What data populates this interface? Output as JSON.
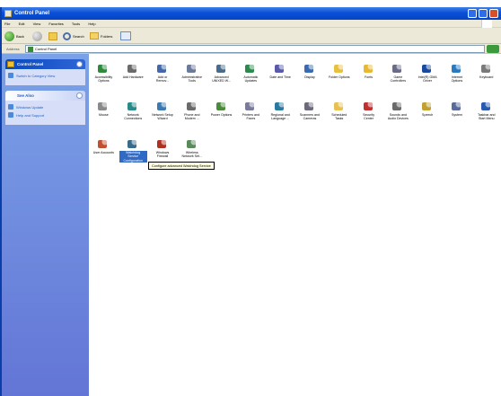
{
  "window": {
    "title": "Control Panel"
  },
  "menu": [
    "File",
    "Edit",
    "View",
    "Favorites",
    "Tools",
    "Help"
  ],
  "toolbar": {
    "back": "Back",
    "search": "Search",
    "folders": "Folders"
  },
  "address": {
    "label": "Address",
    "value": "Control Panel"
  },
  "sidebar": {
    "panel1": {
      "title": "Control Panel",
      "links": [
        "Switch to Category View"
      ]
    },
    "panel2": {
      "title": "See Also",
      "links": [
        "Windows Update",
        "Help and Support"
      ]
    }
  },
  "items": [
    {
      "label": "Accessibility\nOptions",
      "icon": "accessibility-icon",
      "color": "#2e8a3a"
    },
    {
      "label": "Add Hardware",
      "icon": "hardware-icon",
      "color": "#6a6a6a"
    },
    {
      "label": "Add or\nRemov...",
      "icon": "add-remove-programs-icon",
      "color": "#4466aa"
    },
    {
      "label": "Administrative\nTools",
      "icon": "admin-tools-icon",
      "color": "#6a7a9a"
    },
    {
      "label": "Advanced\nUNIXED W...",
      "icon": "advanced-icon",
      "color": "#4a6a8a"
    },
    {
      "label": "Automatic\nUpdates",
      "icon": "updates-icon",
      "color": "#2a8a4a"
    },
    {
      "label": "Date and Time",
      "icon": "date-time-icon",
      "color": "#5a5aaa"
    },
    {
      "label": "Display",
      "icon": "display-icon",
      "color": "#3a6ab0"
    },
    {
      "label": "Folder Options",
      "icon": "folder-options-icon",
      "color": "#e8c040"
    },
    {
      "label": "Fonts",
      "icon": "fonts-icon",
      "color": "#e8b830"
    },
    {
      "label": "Game\nControllers",
      "icon": "game-controller-icon",
      "color": "#6a6a8a"
    },
    {
      "label": "Intel(R) GMA\nDriver",
      "icon": "intel-driver-icon",
      "color": "#1a4aa0"
    },
    {
      "label": "Internet\nOptions",
      "icon": "internet-options-icon",
      "color": "#2a7ac0"
    },
    {
      "label": "Keyboard",
      "icon": "keyboard-icon",
      "color": "#7a7a7a"
    },
    {
      "label": "Mouse",
      "icon": "mouse-icon",
      "color": "#8a8a8a"
    },
    {
      "label": "Network\nConnections",
      "icon": "network-connections-icon",
      "color": "#2a8a8a"
    },
    {
      "label": "Network Setup\nWizard",
      "icon": "network-wizard-icon",
      "color": "#3a7ab0"
    },
    {
      "label": "Phone and\nModem ...",
      "icon": "phone-modem-icon",
      "color": "#6a6a6a"
    },
    {
      "label": "Power Options",
      "icon": "power-options-icon",
      "color": "#4a8a3a"
    },
    {
      "label": "Printers and\nFaxes",
      "icon": "printer-icon",
      "color": "#7a7a9a"
    },
    {
      "label": "Regional and\nLanguage ...",
      "icon": "globe-icon",
      "color": "#2a7aa0"
    },
    {
      "label": "Scanners and\nCameras",
      "icon": "scanner-icon",
      "color": "#6a6a7a"
    },
    {
      "label": "Scheduled\nTasks",
      "icon": "scheduled-tasks-icon",
      "color": "#e8c050"
    },
    {
      "label": "Security\nCenter",
      "icon": "shield-icon",
      "color": "#c03030"
    },
    {
      "label": "Sounds and\nAudio Devices",
      "icon": "sounds-icon",
      "color": "#6a6a6a"
    },
    {
      "label": "Speech",
      "icon": "speech-icon",
      "color": "#c0a030"
    },
    {
      "label": "System",
      "icon": "system-icon",
      "color": "#5a6a9a"
    },
    {
      "label": "Taskbar and\nStart Menu",
      "icon": "taskbar-icon",
      "color": "#2a5ab0"
    },
    {
      "label": "User Accounts",
      "icon": "user-accounts-icon",
      "color": "#c05030"
    },
    {
      "label": "Watchdog\nService\nConfiguration",
      "icon": "watchdog-icon",
      "color": "#3a6a8a",
      "selected": true
    },
    {
      "label": "Windows\nFirewall",
      "icon": "firewall-icon",
      "color": "#b03020"
    },
    {
      "label": "Wireless\nNetwork Set...",
      "icon": "wireless-icon",
      "color": "#5a8a5a"
    }
  ],
  "tooltip": "Configure advanced Watchdog Service"
}
